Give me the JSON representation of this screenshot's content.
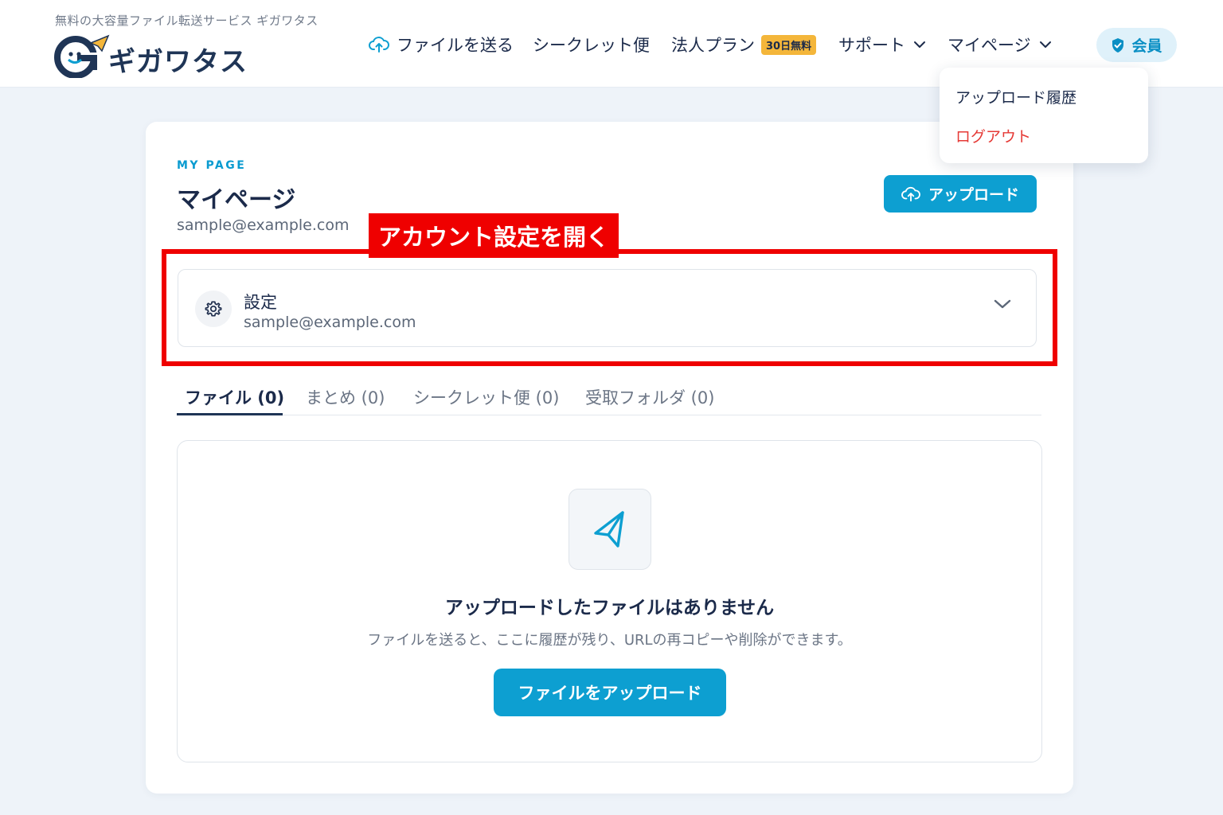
{
  "header": {
    "tagline": "無料の大容量ファイル転送サービス ギガワタス",
    "logo_text": "ギガワタス",
    "nav": {
      "send": "ファイルを送る",
      "secret": "シークレット便",
      "corporate": "法人プラン",
      "corporate_badge": "30日無料",
      "support": "サポート",
      "mypage": "マイページ"
    },
    "member_label": "会員"
  },
  "dropdown": {
    "items": [
      {
        "label": "アップロード履歴"
      },
      {
        "label": "ログアウト"
      }
    ]
  },
  "page": {
    "eyebrow": "MY PAGE",
    "title": "マイページ",
    "email": "sample@example.com",
    "upload_button": "アップロード"
  },
  "annotation": {
    "callout": "アカウント設定を開く"
  },
  "settings": {
    "title": "設定",
    "email": "sample@example.com"
  },
  "tabs": [
    {
      "label": "ファイル (0)"
    },
    {
      "label": "まとめ (0)"
    },
    {
      "label": "シークレット便 (0)"
    },
    {
      "label": "受取フォルダ (0)"
    }
  ],
  "empty": {
    "title": "アップロードしたファイルはありません",
    "description": "ファイルを送ると、ここに履歴が残り、URLの再コピーや削除ができます。",
    "button": "ファイルをアップロード"
  },
  "colors": {
    "accent": "#0d9fd1",
    "brand_navy": "#1f3556",
    "logout_red": "#e53935",
    "annotation_red": "#ef0000",
    "badge_yellow": "#f4b63a"
  }
}
